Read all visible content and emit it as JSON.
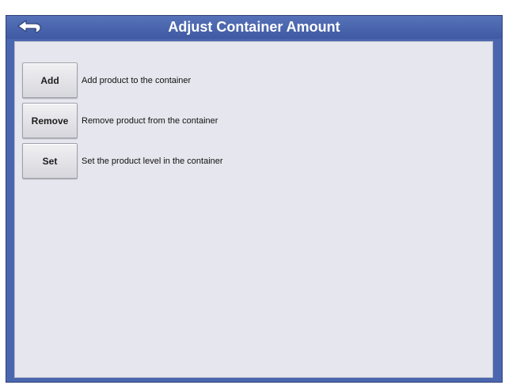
{
  "header": {
    "title": "Adjust Container Amount",
    "back_icon": "back-arrow-icon"
  },
  "colors": {
    "titlebar": "#4a66ae",
    "content_bg": "#e6e6ee",
    "button_bg": "#e4e4e8"
  },
  "actions": [
    {
      "label": "Add",
      "description": "Add product to the container"
    },
    {
      "label": "Remove",
      "description": "Remove product from the container"
    },
    {
      "label": "Set",
      "description": "Set the product level in the container"
    }
  ]
}
